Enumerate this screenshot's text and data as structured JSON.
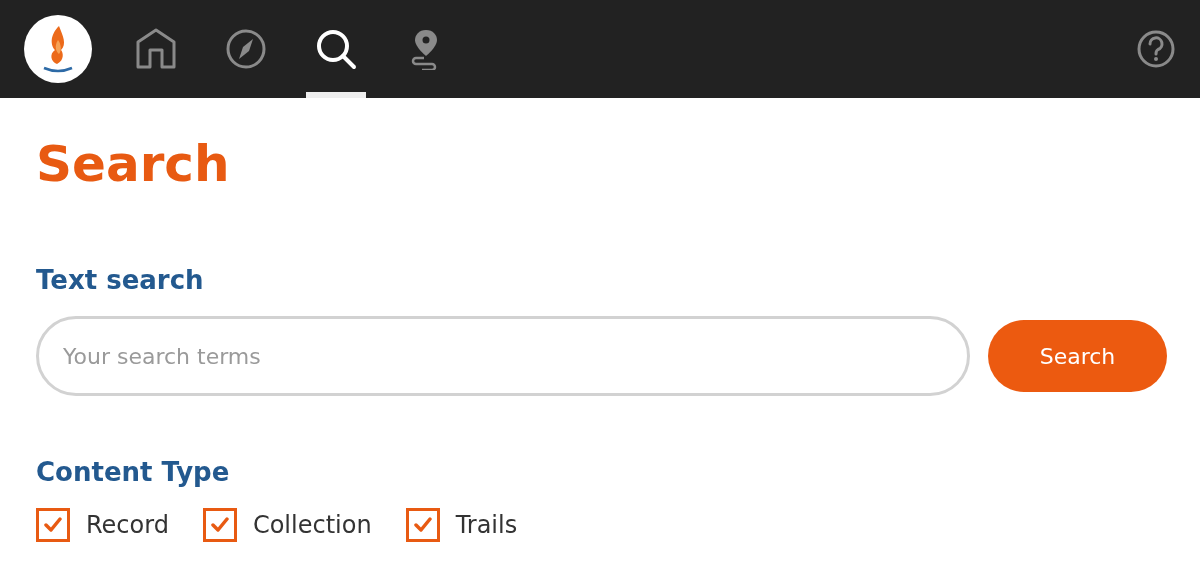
{
  "nav": [
    {
      "kind": "home",
      "selected": false
    },
    {
      "kind": "compass",
      "selected": false
    },
    {
      "kind": "search",
      "selected": true
    },
    {
      "kind": "route",
      "selected": false
    }
  ],
  "title": "Search",
  "text_search": {
    "heading": "Text search",
    "placeholder": "Your search terms",
    "button": "Search"
  },
  "content_type": {
    "heading": "Content Type",
    "options": [
      {
        "label": "Record",
        "checked": true
      },
      {
        "label": "Collection",
        "checked": true
      },
      {
        "label": "Trails",
        "checked": true
      }
    ]
  }
}
